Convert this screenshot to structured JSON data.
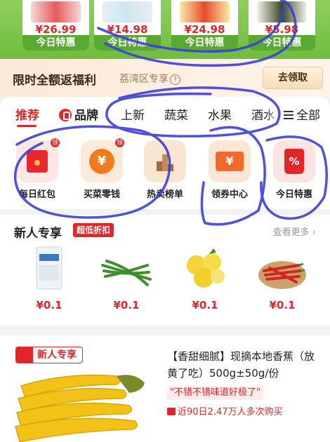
{
  "top_products": [
    {
      "price": "¥26.99",
      "tag": "今日特惠"
    },
    {
      "price": "¥14.98",
      "tag": "今日特惠"
    },
    {
      "price": "¥24.98",
      "tag": "今日特惠"
    },
    {
      "price": "¥5.98",
      "tag": "今日特惠"
    }
  ],
  "promo": {
    "title": "限时全额返福利",
    "subtitle": "荔湾区专享",
    "help_symbol": "?",
    "button": "去领取"
  },
  "tabs": [
    {
      "label": "推荐",
      "active": true
    },
    {
      "label": "品牌",
      "icon": "brand-icon"
    },
    {
      "label": "上新"
    },
    {
      "label": "蔬菜"
    },
    {
      "label": "水果"
    },
    {
      "label": "酒水"
    }
  ],
  "all_label": "全部",
  "quick_icons": [
    {
      "label": "每日红包",
      "badge": "领",
      "icon": "red-envelope-icon"
    },
    {
      "label": "买菜零钱",
      "badge": "领",
      "icon": "yuan-coin-icon",
      "symbol": "¥"
    },
    {
      "label": "热卖榜单",
      "icon": "ranking-icon"
    },
    {
      "label": "领券中心",
      "icon": "coupon-icon",
      "symbol": "¥"
    },
    {
      "label": "今日特惠",
      "icon": "discount-tag-icon",
      "symbol": "%"
    }
  ],
  "new_user": {
    "title": "新人专享",
    "badge": "超低折扣",
    "see_more": "查看更多",
    "items": [
      {
        "price": "¥0.1",
        "icon": "salt-bag-icon"
      },
      {
        "price": "¥0.1",
        "icon": "green-beans-icon"
      },
      {
        "price": "¥0.1",
        "icon": "lemon-icon"
      },
      {
        "price": "¥0.1",
        "icon": "red-chili-icon"
      }
    ]
  },
  "product": {
    "tag": "新人专享",
    "name": "【香甜细腻】现摘本地香蕉（放黄了吃）500g±50g/份",
    "quote": "\"不错不错味道好极了\"",
    "sales": "近90日2.47万人多次购买"
  },
  "colors": {
    "accent_red": "#e0262b",
    "green": "#6fbd3f",
    "annotation_blue": "#3b3fd8"
  }
}
